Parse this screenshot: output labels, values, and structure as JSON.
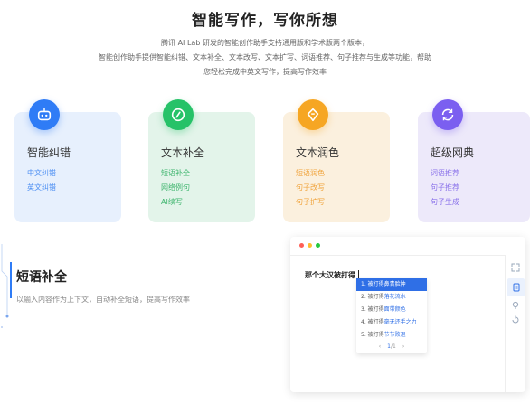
{
  "hero": {
    "title": "智能写作，写你所想",
    "desc_lines": [
      "腾讯 AI Lab 研发的智能创作助手支持通用版和学术版两个版本，",
      "智能创作助手提供智能纠错、文本补全、文本改写、文本扩写、词语推荐、句子推荐与生成等功能，帮助",
      "您轻松完成中英文写作，提高写作效率"
    ]
  },
  "cards": [
    {
      "name": "智能纠错",
      "icon": "robot-icon",
      "color": "#2f7cf6",
      "links": [
        "中文纠错",
        "英文纠错"
      ]
    },
    {
      "name": "文本补全",
      "icon": "edit-circle-icon",
      "color": "#26c268",
      "links": [
        "短语补全",
        "网络例句",
        "AI续写"
      ]
    },
    {
      "name": "文本润色",
      "icon": "pen-diamond-icon",
      "color": "#f6a623",
      "links": [
        "短语润色",
        "句子改写",
        "句子扩写"
      ]
    },
    {
      "name": "超级网典",
      "icon": "refresh-icon",
      "color": "#7b5ff0",
      "links": [
        "词语推荐",
        "句子推荐",
        "句子生成"
      ]
    }
  ],
  "section": {
    "title": "短语补全",
    "desc": "以输入内容作为上下文，自动补全短语，提高写作效率"
  },
  "demo": {
    "input_text": "那个大汉被打得",
    "suggestions": [
      {
        "num": "1.",
        "prefix": "被打得",
        "suffix": "鼻青脸肿"
      },
      {
        "num": "2.",
        "prefix": "被打得",
        "suffix": "落花流水"
      },
      {
        "num": "3.",
        "prefix": "被打得",
        "suffix": "面带颜色"
      },
      {
        "num": "4.",
        "prefix": "被打得",
        "suffix": "毫无还手之力"
      },
      {
        "num": "5.",
        "prefix": "被打得",
        "suffix": "节节败退"
      }
    ],
    "pager": {
      "prev": "‹",
      "page": "1",
      "sep": "/",
      "total": "1",
      "next": "›"
    },
    "tools": [
      "expand-icon",
      "document-icon",
      "bulb-icon",
      "undo-icon"
    ]
  }
}
